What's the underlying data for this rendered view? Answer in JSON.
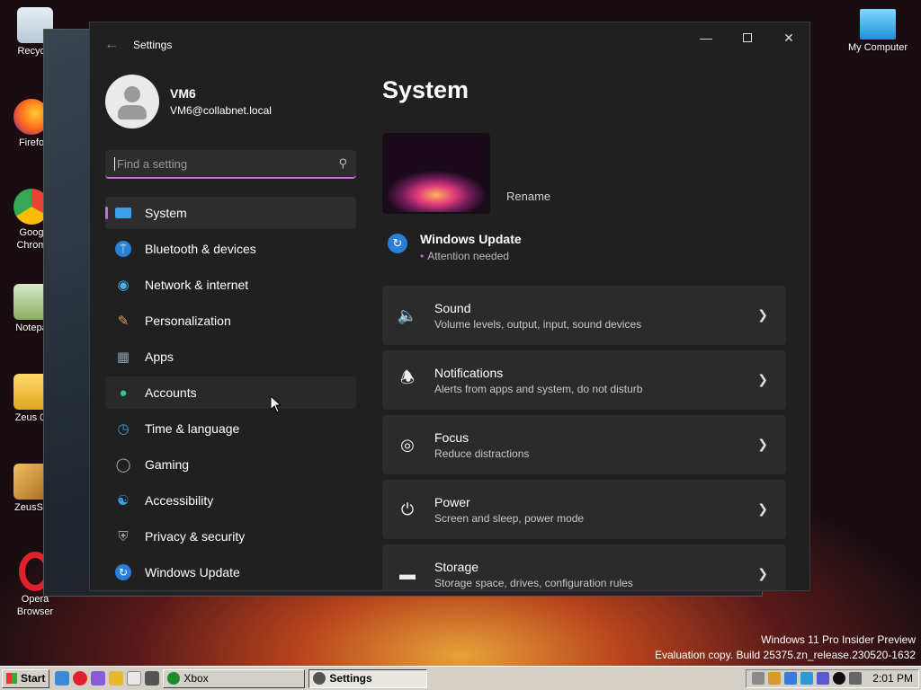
{
  "desktop": {
    "icons": [
      {
        "label": "Recycle",
        "icon": "recycle-bin-icon"
      },
      {
        "label": "Firefo",
        "icon": "firefox-icon"
      },
      {
        "label": "Goog\nChrom",
        "icon": "chrome-icon"
      },
      {
        "label": "Notepa",
        "icon": "notepad-icon"
      },
      {
        "label": "Zeus 0.",
        "icon": "folder-icon"
      },
      {
        "label": "ZeusSe",
        "icon": "package-icon"
      },
      {
        "label": "Opera\nBrowser",
        "icon": "opera-icon"
      },
      {
        "label": "My Computer",
        "icon": "monitor-icon"
      }
    ]
  },
  "settings": {
    "window_title": "Settings",
    "user": {
      "name": "VM6",
      "email": "VM6@collabnet.local"
    },
    "search": {
      "placeholder": "Find a setting"
    },
    "nav": [
      {
        "label": "System",
        "icon": "monitor-icon",
        "color": "#3aa0e8"
      },
      {
        "label": "Bluetooth & devices",
        "icon": "bluetooth-icon",
        "color": "#2a7fd8"
      },
      {
        "label": "Network & internet",
        "icon": "wifi-icon",
        "color": "#4ab0f0"
      },
      {
        "label": "Personalization",
        "icon": "brush-icon",
        "color": "#e0a060"
      },
      {
        "label": "Apps",
        "icon": "apps-icon",
        "color": "#8a9ab0"
      },
      {
        "label": "Accounts",
        "icon": "person-icon",
        "color": "#2ec4a0"
      },
      {
        "label": "Time & language",
        "icon": "globe-clock-icon",
        "color": "#3aa0e8"
      },
      {
        "label": "Gaming",
        "icon": "gamepad-icon",
        "color": "#b0b0b0"
      },
      {
        "label": "Accessibility",
        "icon": "accessibility-icon",
        "color": "#3aa0e8"
      },
      {
        "label": "Privacy & security",
        "icon": "shield-icon",
        "color": "#9aa0a8"
      },
      {
        "label": "Windows Update",
        "icon": "sync-icon",
        "color": "#2a7fd8"
      }
    ],
    "page_title": "System",
    "rename_label": "Rename",
    "windows_update": {
      "title": "Windows Update",
      "status": "Attention needed"
    },
    "cards": [
      {
        "title": "Sound",
        "subtitle": "Volume levels, output, input, sound devices",
        "icon": "speaker-icon"
      },
      {
        "title": "Notifications",
        "subtitle": "Alerts from apps and system, do not disturb",
        "icon": "bell-icon"
      },
      {
        "title": "Focus",
        "subtitle": "Reduce distractions",
        "icon": "focus-icon"
      },
      {
        "title": "Power",
        "subtitle": "Screen and sleep, power mode",
        "icon": "power-icon"
      },
      {
        "title": "Storage",
        "subtitle": "Storage space, drives, configuration rules",
        "icon": "storage-icon"
      }
    ]
  },
  "watermark": {
    "line1": "Windows 11 Pro Insider Preview",
    "line2": "Evaluation copy. Build 25375.zn_release.230520-1632"
  },
  "taskbar": {
    "start_label": "Start",
    "tasks": [
      {
        "label": "Xbox"
      },
      {
        "label": "Settings"
      }
    ],
    "clock": "2:01 PM"
  }
}
